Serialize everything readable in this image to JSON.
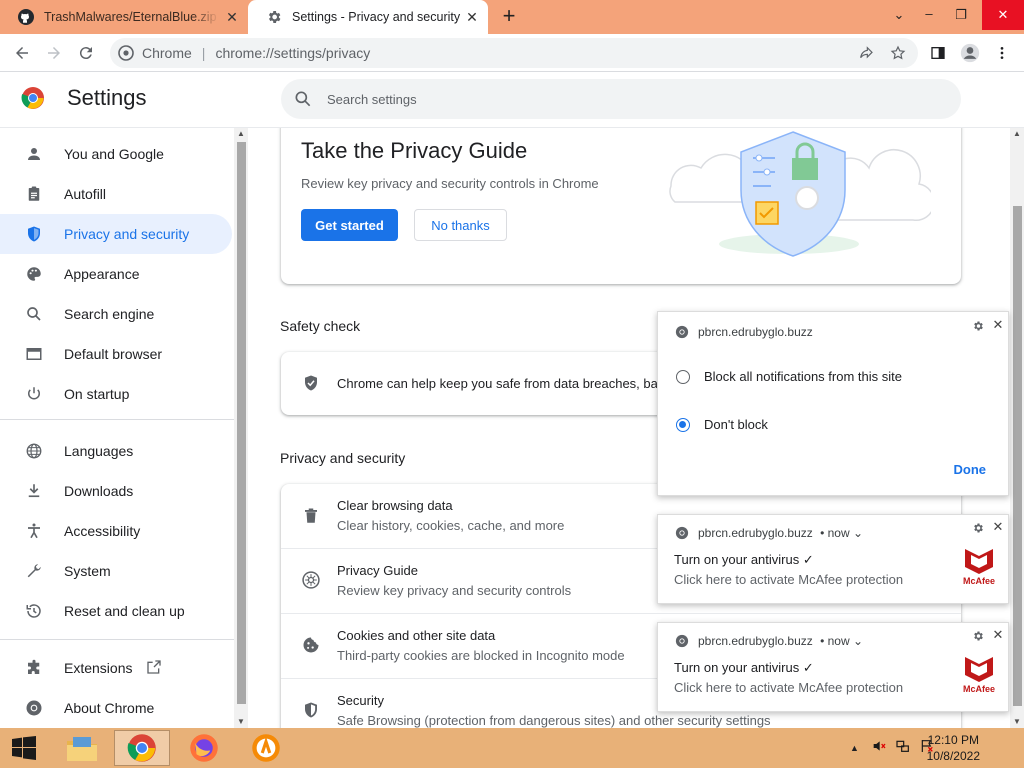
{
  "browser": {
    "tabs": [
      {
        "label": "TrashMalwares/EternalBlue.zip at",
        "icon": "github-icon",
        "active": false
      },
      {
        "label": "Settings - Privacy and security",
        "icon": "gear-icon",
        "active": true
      }
    ],
    "omnibox": {
      "chip": "Chrome",
      "url": "chrome://settings/privacy"
    }
  },
  "settings": {
    "title": "Settings",
    "search_placeholder": "Search settings",
    "nav": [
      {
        "label": "You and Google",
        "icon": "person-icon"
      },
      {
        "label": "Autofill",
        "icon": "clipboard-icon"
      },
      {
        "label": "Privacy and security",
        "icon": "shield-icon",
        "active": true
      },
      {
        "label": "Appearance",
        "icon": "palette-icon"
      },
      {
        "label": "Search engine",
        "icon": "search-icon"
      },
      {
        "label": "Default browser",
        "icon": "browser-icon"
      },
      {
        "label": "On startup",
        "icon": "power-icon"
      },
      {
        "label": "Languages",
        "icon": "globe-icon"
      },
      {
        "label": "Downloads",
        "icon": "download-icon"
      },
      {
        "label": "Accessibility",
        "icon": "accessibility-icon"
      },
      {
        "label": "System",
        "icon": "wrench-icon"
      },
      {
        "label": "Reset and clean up",
        "icon": "history-icon"
      },
      {
        "label": "Extensions",
        "icon": "puzzle-icon"
      },
      {
        "label": "About Chrome",
        "icon": "chrome-icon"
      }
    ],
    "guide": {
      "title": "Take the Privacy Guide",
      "subtitle": "Review key privacy and security controls in Chrome",
      "primary": "Get started",
      "secondary": "No thanks"
    },
    "safety_check": {
      "section": "Safety check",
      "text": "Chrome can help keep you safe from data breaches, bad"
    },
    "privacy_section": {
      "section": "Privacy and security",
      "rows": [
        {
          "title": "Clear browsing data",
          "sub": "Clear history, cookies, cache, and more",
          "icon": "trash-icon"
        },
        {
          "title": "Privacy Guide",
          "sub": "Review key privacy and security controls",
          "icon": "compass-icon"
        },
        {
          "title": "Cookies and other site data",
          "sub": "Third-party cookies are blocked in Incognito mode",
          "icon": "cookie-icon"
        },
        {
          "title": "Security",
          "sub": "Safe Browsing (protection from dangerous sites) and other security settings",
          "icon": "shield-outline-icon"
        }
      ]
    }
  },
  "permission_popup": {
    "origin": "pbrcn.edrubyglo.buzz",
    "options": [
      {
        "label": "Block all notifications from this site",
        "selected": false
      },
      {
        "label": "Don't block",
        "selected": true
      }
    ],
    "done": "Done"
  },
  "notifications": [
    {
      "origin": "pbrcn.edrubyglo.buzz",
      "time": "• now ⌄",
      "title": "Turn on your antivirus ✓",
      "body": "Click here to activate McAfee protection",
      "brand": "McAfee"
    },
    {
      "origin": "pbrcn.edrubyglo.buzz",
      "time": "• now ⌄",
      "title": "Turn on your antivirus ✓",
      "body": "Click here to activate McAfee protection",
      "brand": "McAfee"
    }
  ],
  "taskbar": {
    "apps": [
      "file-explorer-icon",
      "chrome-icon",
      "firefox-icon",
      "avast-icon"
    ],
    "time": "12:10 PM",
    "date": "10/8/2022"
  },
  "colors": {
    "accent": "#1a73e8",
    "tabstrip": "#f4a37a",
    "taskbar": "#e8b178",
    "mcafee_red": "#c01818"
  }
}
